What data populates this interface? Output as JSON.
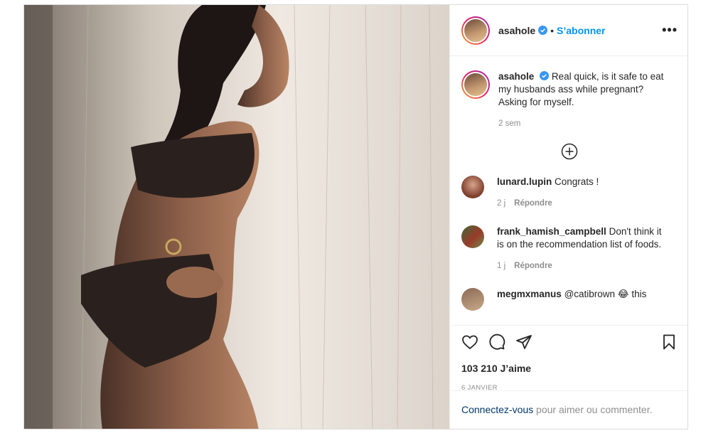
{
  "post": {
    "author": "asahole",
    "follow_label": "S’abonner",
    "dot": "•",
    "more_label": "•••"
  },
  "caption": {
    "username": "asahole",
    "text": "Real quick, is it safe to eat my husbands ass while pregnant? Asking for myself.",
    "time": "2 sem"
  },
  "comments": [
    {
      "username": "lunard.lupin",
      "text": "Congrats !",
      "time": "2 j",
      "reply_label": "Répondre"
    },
    {
      "username": "frank_hamish_campbell",
      "text": "Don't think it is on the recommendation list of foods.",
      "time": "1 j",
      "reply_label": "Répondre"
    },
    {
      "username": "megmxmanus",
      "text": "@catibrown 😂 this"
    }
  ],
  "footer": {
    "likes": "103 210 J’aime",
    "date": "6 JANVIER",
    "login_link": "Connectez-vous",
    "login_rest": " pour aimer ou commenter."
  },
  "icons": [
    "verified-badge-icon",
    "more-options-icon",
    "load-more-plus-icon",
    "heart-icon",
    "comment-icon",
    "share-icon",
    "bookmark-icon"
  ],
  "colors": {
    "accent": "#0095f6",
    "verified": "#3897f0",
    "muted": "#8e8e8e"
  }
}
